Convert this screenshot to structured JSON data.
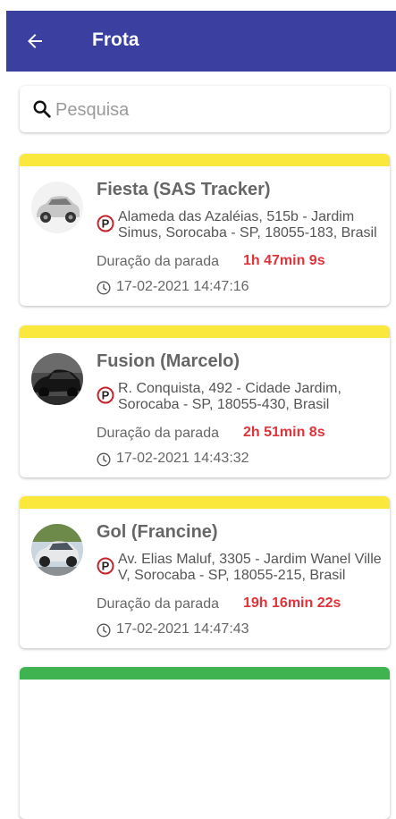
{
  "appbar": {
    "title": "Frota",
    "back_icon": "arrow-left-icon"
  },
  "search": {
    "placeholder": "Pesquisa",
    "value": "",
    "icon": "search-icon"
  },
  "labels": {
    "duration": "Duração da parada"
  },
  "vehicles": [
    {
      "name": "Fiesta (SAS Tracker)",
      "address": "Alameda das Azaléias, 515b - Jardim Simus, Sorocaba - SP, 18055-183, Brasil",
      "duration": "1h 47min 9s",
      "timestamp": "17-02-2021 14:47:16",
      "status_color": "#fbe83c"
    },
    {
      "name": "Fusion (Marcelo)",
      "address": "R. Conquista, 492 - Cidade Jardim, Sorocaba - SP, 18055-430, Brasil",
      "duration": "2h 51min 8s",
      "timestamp": "17-02-2021 14:43:32",
      "status_color": "#fbe83c"
    },
    {
      "name": "Gol (Francine)",
      "address": "Av. Elias Maluf, 3305 - Jardim Wanel Ville V, Sorocaba - SP, 18055-215, Brasil",
      "duration": "19h 16min 22s",
      "timestamp": "17-02-2021 14:47:43",
      "status_color": "#fbe83c"
    },
    {
      "status_color": "#3fb34f"
    }
  ],
  "colors": {
    "appbar": "#3a3fa0",
    "duration_value": "#e0333a"
  }
}
